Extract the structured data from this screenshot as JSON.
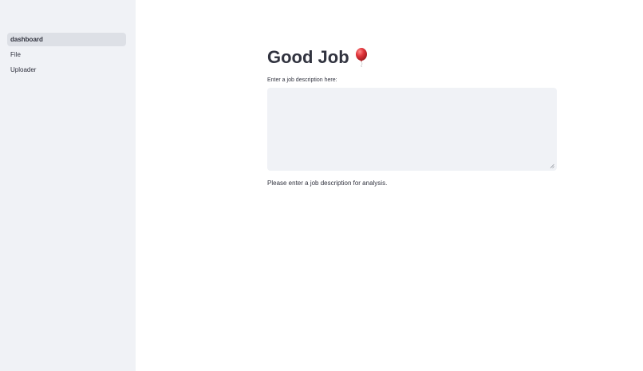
{
  "sidebar": {
    "items": [
      {
        "label": "dashboard",
        "active": true
      },
      {
        "label": "File",
        "active": false
      },
      {
        "label": "Uploader",
        "active": false
      }
    ]
  },
  "main": {
    "title": "Good Job",
    "title_icon": "balloon-icon",
    "input_label": "Enter a job description here:",
    "input_value": "",
    "message": "Please enter a job description for analysis."
  },
  "colors": {
    "sidebar_bg": "#f0f2f6",
    "active_item_bg": "#dde0e6",
    "text": "#31333f",
    "balloon": "#e0343a"
  }
}
